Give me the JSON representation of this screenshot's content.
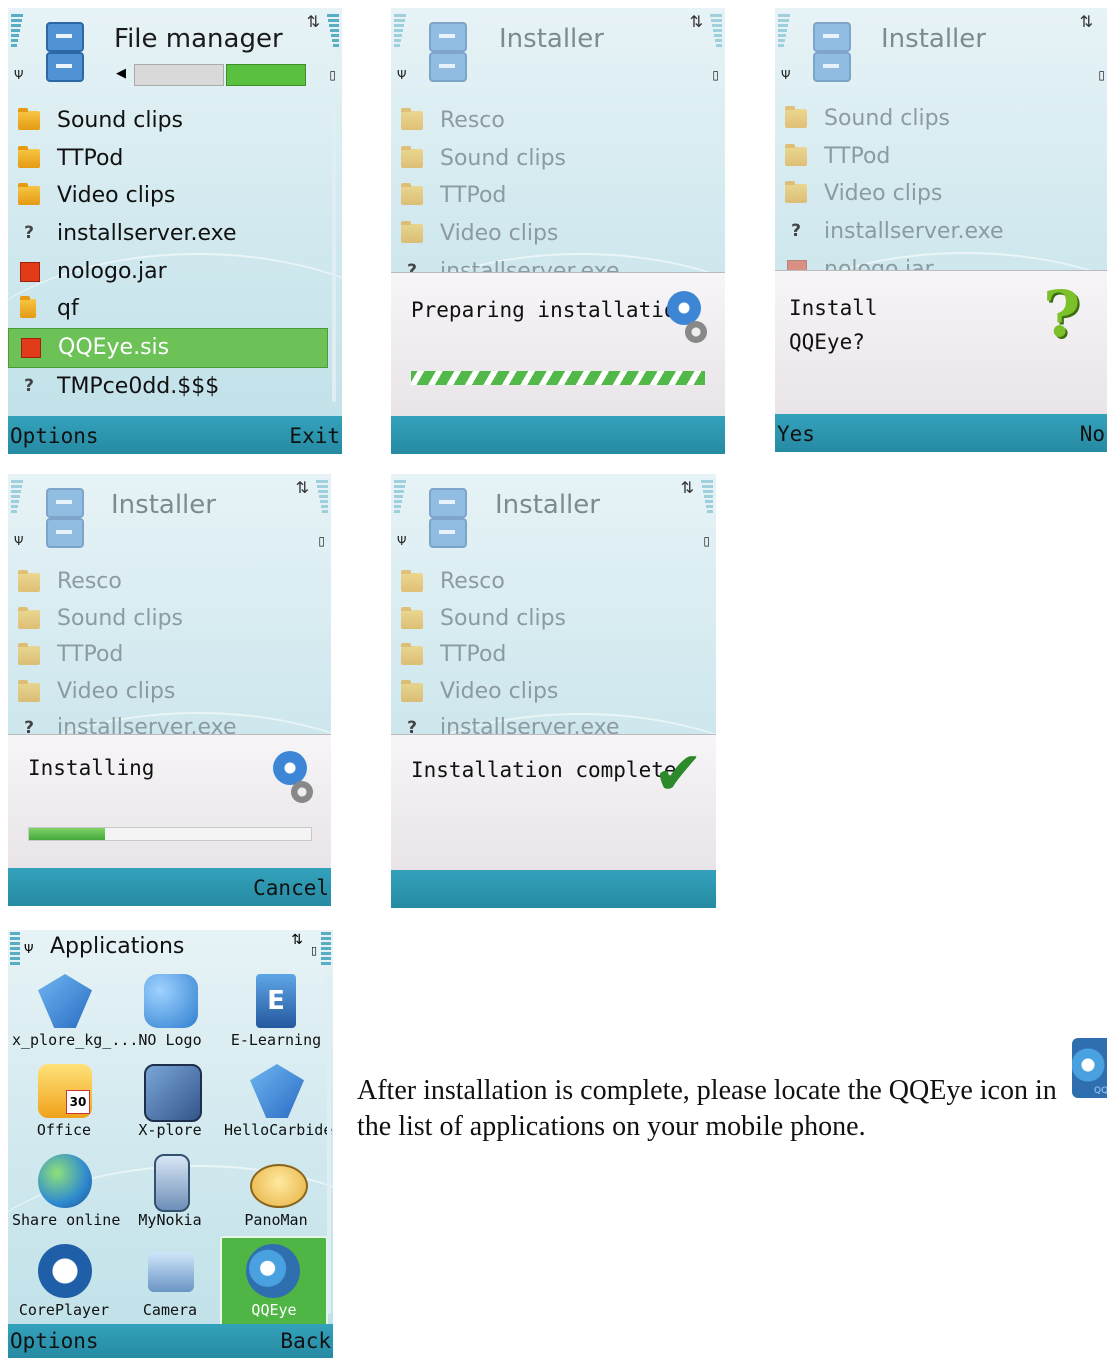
{
  "screen1": {
    "title": "File manager",
    "items": [
      {
        "icon": "folder-icon",
        "label": "Sound clips"
      },
      {
        "icon": "folder-icon",
        "label": "TTPod"
      },
      {
        "icon": "folder-icon",
        "label": "Video clips"
      },
      {
        "icon": "unknown-file-icon",
        "label": "installserver.exe"
      },
      {
        "icon": "java-app-icon",
        "label": "nologo.jar"
      },
      {
        "icon": "note-folder-icon",
        "label": "qf"
      },
      {
        "icon": "java-app-icon",
        "label": "QQEye.sis"
      },
      {
        "icon": "unknown-file-icon",
        "label": "TMPce0dd.$$$"
      }
    ],
    "selected_index": 6,
    "softkeys": {
      "left": "Options",
      "right": "Exit"
    }
  },
  "screen2": {
    "title": "Installer",
    "items": [
      "Resco",
      "Sound clips",
      "TTPod",
      "Video clips",
      "installserver.exe"
    ],
    "dialog_text": "Preparing installation",
    "softkeys": {
      "left": "",
      "right": ""
    }
  },
  "screen3": {
    "title": "Installer",
    "items": [
      "Sound clips",
      "TTPod",
      "Video clips",
      "installserver.exe",
      "nologo.jar"
    ],
    "dialog_line1": "Install",
    "dialog_line2": "QQEye?",
    "softkeys": {
      "left": "Yes",
      "right": "No"
    }
  },
  "screen4": {
    "title": "Installer",
    "items": [
      "Resco",
      "Sound clips",
      "TTPod",
      "Video clips",
      "installserver.exe"
    ],
    "dialog_text": "Installing",
    "progress": 0.27,
    "softkeys": {
      "left": "",
      "right": "Cancel"
    }
  },
  "screen5": {
    "title": "Installer",
    "items": [
      "Resco",
      "Sound clips",
      "TTPod",
      "Video clips",
      "installserver.exe"
    ],
    "dialog_text": "Installation complete",
    "softkeys": {
      "left": "",
      "right": ""
    }
  },
  "screen6": {
    "title": "Applications",
    "apps": [
      {
        "label": "x_plore_kg_...",
        "icon": "x-plore-icon"
      },
      {
        "label": "NO Logo",
        "icon": "puzzle-icon"
      },
      {
        "label": "E-Learning",
        "icon": "e-learning-icon"
      },
      {
        "label": "Office",
        "icon": "calendar-folder-icon"
      },
      {
        "label": "X-plore",
        "icon": "x-plore-folders-icon"
      },
      {
        "label": "HelloCarbide",
        "icon": "hello-carbide-icon"
      },
      {
        "label": "Share online",
        "icon": "globe-icon"
      },
      {
        "label": "MyNokia",
        "icon": "phone-icon"
      },
      {
        "label": "PanoMan",
        "icon": "panoman-icon"
      },
      {
        "label": "CorePlayer",
        "icon": "play-icon"
      },
      {
        "label": "Camera",
        "icon": "camera-icon"
      },
      {
        "label": "QQEye",
        "icon": "qqeye-icon"
      }
    ],
    "selected_index": 11,
    "softkeys": {
      "left": "Options",
      "right": "Back"
    }
  },
  "caption": "After installation is complete, please locate the QQEye icon in the list of applications on your mobile phone.",
  "caption_icon_label": "QQ"
}
